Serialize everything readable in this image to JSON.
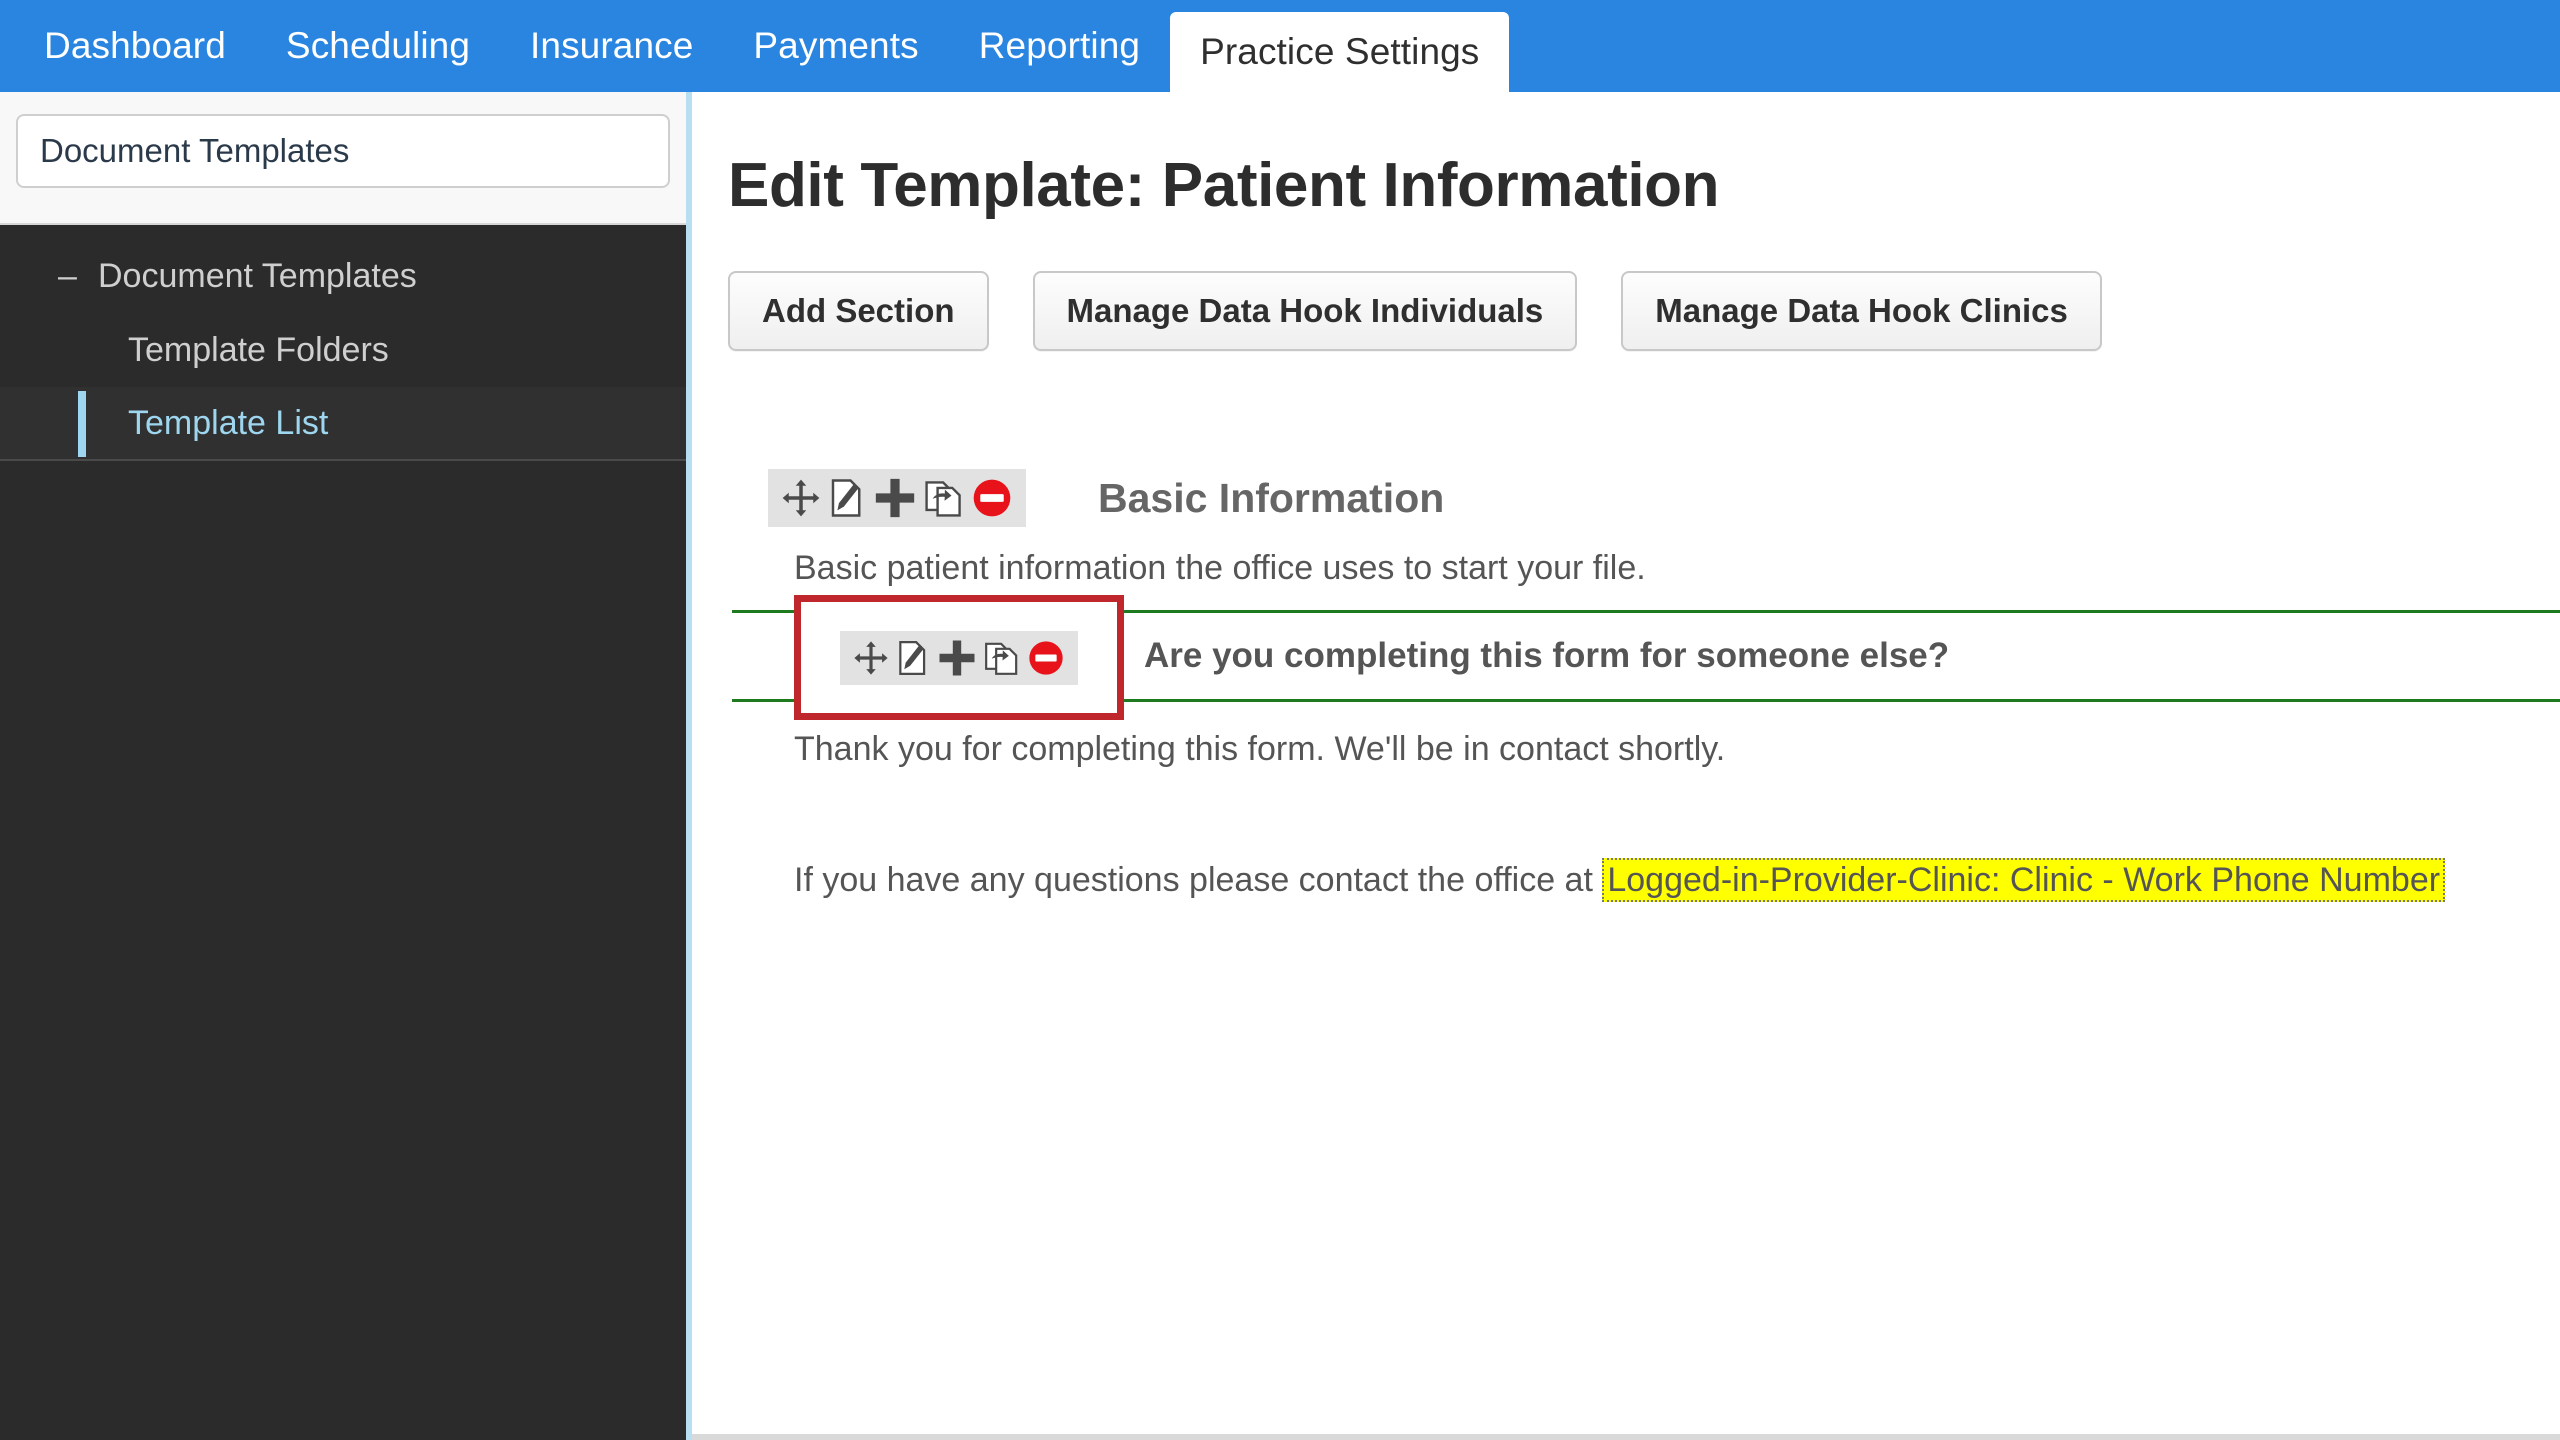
{
  "topnav": {
    "items": [
      {
        "label": "Dashboard",
        "active": false
      },
      {
        "label": "Scheduling",
        "active": false
      },
      {
        "label": "Insurance",
        "active": false
      },
      {
        "label": "Payments",
        "active": false
      },
      {
        "label": "Reporting",
        "active": false
      },
      {
        "label": "Practice Settings",
        "active": true
      }
    ],
    "accent_color": "#2a85e0"
  },
  "sidebar": {
    "search": {
      "value": "Document Templates",
      "placeholder": ""
    },
    "tree": [
      {
        "label": "Document Templates",
        "level": 1,
        "expander": "–",
        "active": false
      },
      {
        "label": "Template Folders",
        "level": 2,
        "active": false
      },
      {
        "label": "Template List",
        "level": 2,
        "active": true
      }
    ],
    "active_color": "#9fd6ef",
    "background": "#2b2b2b"
  },
  "main": {
    "page_title": "Edit Template: Patient Information",
    "buttons": [
      {
        "label": "Add Section"
      },
      {
        "label": "Manage Data Hook Individuals"
      },
      {
        "label": "Manage Data Hook Clinics"
      }
    ],
    "toolbar_icons": [
      {
        "name": "move-icon",
        "title": "Move"
      },
      {
        "name": "edit-icon",
        "title": "Edit"
      },
      {
        "name": "add-icon",
        "title": "Add"
      },
      {
        "name": "duplicate-icon",
        "title": "Duplicate"
      },
      {
        "name": "delete-icon",
        "title": "Delete"
      }
    ],
    "section": {
      "title": "Basic Information",
      "description": "Basic patient information the office uses to start your file."
    },
    "question": {
      "text": "Are you completing this form for someone else?",
      "highlight_border_color": "#c0272d",
      "row_border_color": "#1e7a1e"
    },
    "paragraphs": [
      {
        "text": "Thank you for completing this form. We'll be in contact shortly."
      }
    ],
    "contact_line": {
      "prefix": "If you have any questions please contact the office at ",
      "datahook": "Logged-in-Provider-Clinic: Clinic - Work Phone Number",
      "highlight_color": "#ffff00"
    }
  }
}
